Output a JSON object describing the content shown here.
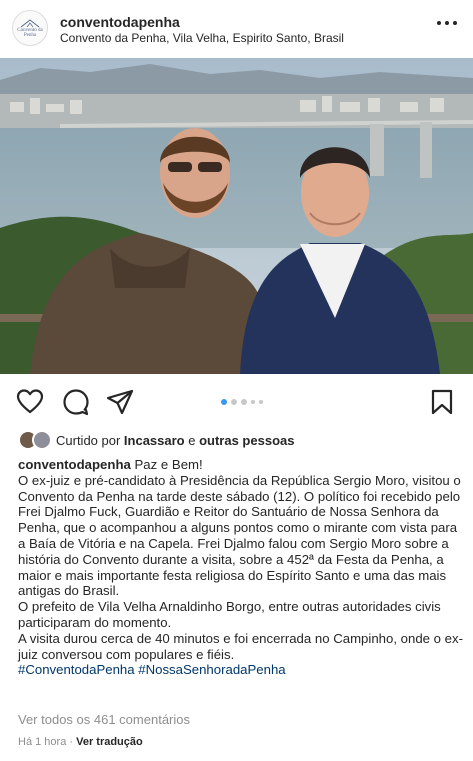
{
  "post": {
    "username": "conventodapenha",
    "location": "Convento da Penha, Vila Velha, Espirito Santo, Brasil",
    "avatar_text": "Convento da Penha"
  },
  "icons": {
    "like": "heart-icon",
    "comment": "comment-icon",
    "share": "send-icon",
    "save": "bookmark-icon",
    "more": "more-options-icon"
  },
  "carousel": {
    "total": 5,
    "active": 1
  },
  "likes": {
    "prefix": "Curtido por ",
    "user": "Incassaro",
    "middle": " e ",
    "others": "outras pessoas"
  },
  "caption": {
    "username": "conventodapenha",
    "greeting": " Paz e Bem!",
    "paragraph1": "O ex-juiz e pré-candidato à Presidência da República Sergio Moro, visitou o Convento da Penha na tarde deste sábado (12). O político foi recebido pelo Frei Djalmo Fuck, Guardião e Reitor do Santuário de Nossa Senhora da Penha, que o acompanhou a alguns pontos como o mirante com vista para a Baía de Vitória e na Capela. Frei Djalmo falou com Sergio Moro sobre a história do Convento durante a visita, sobre a 452ª da Festa da Penha, a maior e mais importante festa religiosa do Espírito Santo e uma das mais antigas do Brasil.",
    "paragraph2": " O prefeito de Vila Velha Arnaldinho Borgo, entre outras autoridades civis participaram do momento.",
    "paragraph3": "A visita durou cerca de 40 minutos e foi encerrada no Campinho, onde o ex-juiz conversou com populares e fiéis.",
    "hashtags": "#ConventodaPenha #NossaSenhoradaPenha"
  },
  "comments_link": "Ver todos os 461 comentários",
  "footer": {
    "time": "Há 1 hora",
    "separator": " · ",
    "translate": "Ver tradução"
  },
  "colors": {
    "text": "#262626",
    "muted": "#8e8e8e",
    "hashtag": "#00376b",
    "dot_active": "#3897f0",
    "dot_inactive": "#c7c7c7"
  }
}
